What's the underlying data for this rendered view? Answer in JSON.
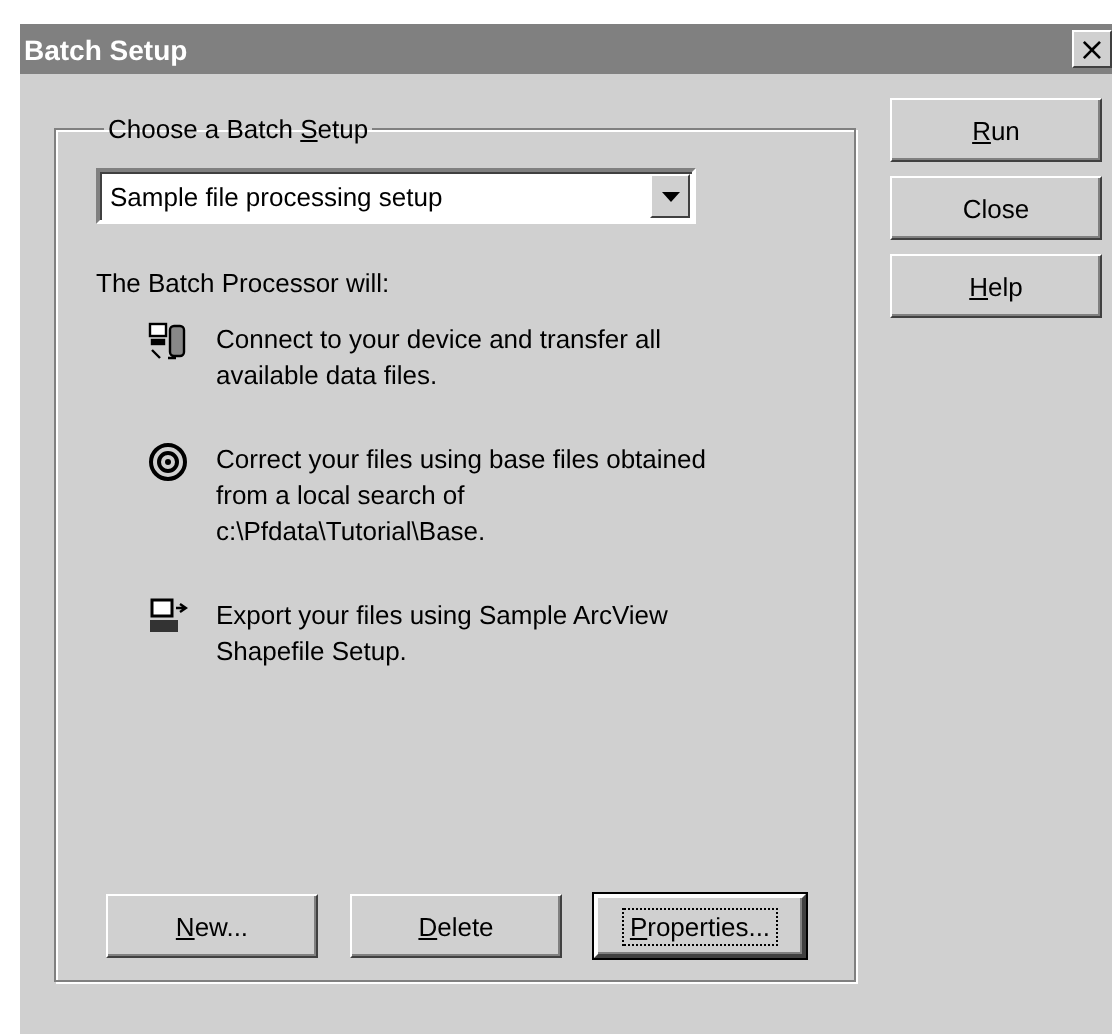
{
  "window": {
    "title": "Batch Setup",
    "close": "×"
  },
  "group": {
    "legend": {
      "pre": "Choose a Batch ",
      "key": "S",
      "post": "etup"
    },
    "setup_select": {
      "value": "Sample file processing setup"
    },
    "intro": "The Batch Processor will:",
    "steps": [
      {
        "kind": "transfer",
        "text": "Connect to your device and transfer all available data files."
      },
      {
        "kind": "correct",
        "text": "Correct your files using base files obtained from a local search of c:\\Pfdata\\Tutorial\\Base."
      },
      {
        "kind": "export",
        "text": "Export your files using Sample ArcView Shapefile Setup."
      }
    ],
    "buttons": [
      {
        "key": "N",
        "post": "ew...",
        "default": false
      },
      {
        "key": "D",
        "post": "elete",
        "default": false
      },
      {
        "key": "P",
        "post": "roperties...",
        "default": true
      }
    ]
  },
  "side_buttons": [
    {
      "key": "R",
      "post": "un"
    },
    {
      "pre": "Close"
    },
    {
      "key": "H",
      "post": "elp"
    }
  ]
}
